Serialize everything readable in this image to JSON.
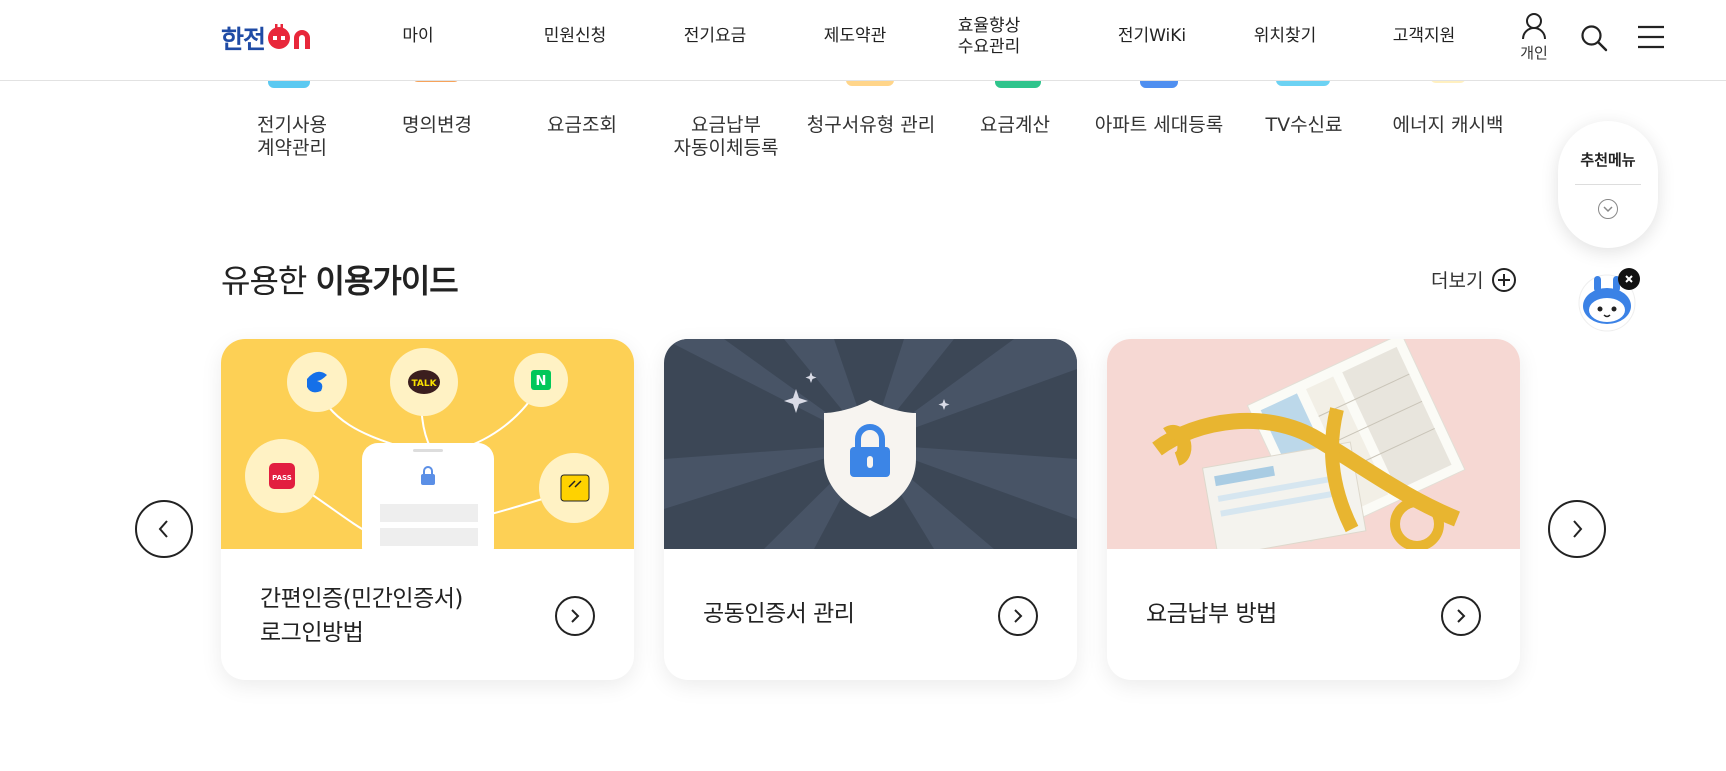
{
  "header": {
    "logo_ko": "한전",
    "logo_on": "ON",
    "nav": [
      "마이",
      "민원신청",
      "전기요금",
      "제도약관",
      "효율향상\n수요관리",
      "전기WiKi",
      "위치찾기",
      "고객지원"
    ],
    "user_label": "개인",
    "icons": [
      "user-icon",
      "search-icon",
      "menu-icon"
    ]
  },
  "quick_menu": [
    "전기사용\n계약관리",
    "명의변경",
    "요금조회",
    "요금납부\n자동이체등록",
    "청구서유형 관리",
    "요금계산",
    "아파트 세대등록",
    "TV수신료",
    "에너지 캐시백"
  ],
  "guide": {
    "title_prefix": "유용한",
    "title_bold": "이용가이드",
    "more_label": "더보기",
    "cards": [
      {
        "label": "간편인증(민간인증서)\n로그인방법",
        "bg": "#fdd055"
      },
      {
        "label": "공동인증서 관리",
        "bg": "#3c4756"
      },
      {
        "label": "요금납부 방법",
        "bg": "#f6d8d3"
      }
    ],
    "app_icons": [
      "PASS",
      "TALK",
      "N"
    ]
  },
  "floating": {
    "recommend_title": "추천메뉴"
  },
  "colors": {
    "brand_blue": "#1f4ba5",
    "brand_red": "#e8273a"
  }
}
